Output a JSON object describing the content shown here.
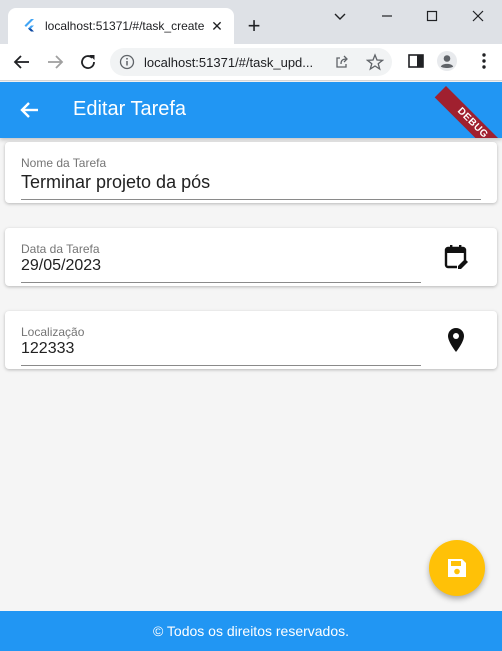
{
  "browser": {
    "tab": {
      "title": "localhost:51371/#/task_create",
      "close_glyph": "✕",
      "favicon": "flutter-icon"
    },
    "new_tab_glyph": "+",
    "address_bar": {
      "url": "localhost:51371/#/task_upd..."
    },
    "icons": [
      "back-arrow-icon",
      "forward-arrow-icon",
      "reload-icon",
      "info-icon",
      "share-icon",
      "star-icon",
      "side-panel-icon",
      "profile-icon",
      "more-vert-icon"
    ]
  },
  "app": {
    "appbar": {
      "title": "Editar Tarefa",
      "debug_banner": "DEBUG",
      "color": "#2196f3"
    },
    "fields": {
      "name": {
        "label": "Nome da Tarefa",
        "value": "Terminar projeto da pós"
      },
      "date": {
        "label": "Data da Tarefa",
        "value": "29/05/2023",
        "icon": "edit-calendar-icon"
      },
      "location": {
        "label": "Localização",
        "value": "122333",
        "icon": "location-pin-icon"
      }
    },
    "fab": {
      "icon": "save-icon",
      "color": "#ffc107"
    },
    "footer": {
      "text": "© Todos os direitos reservados."
    }
  }
}
